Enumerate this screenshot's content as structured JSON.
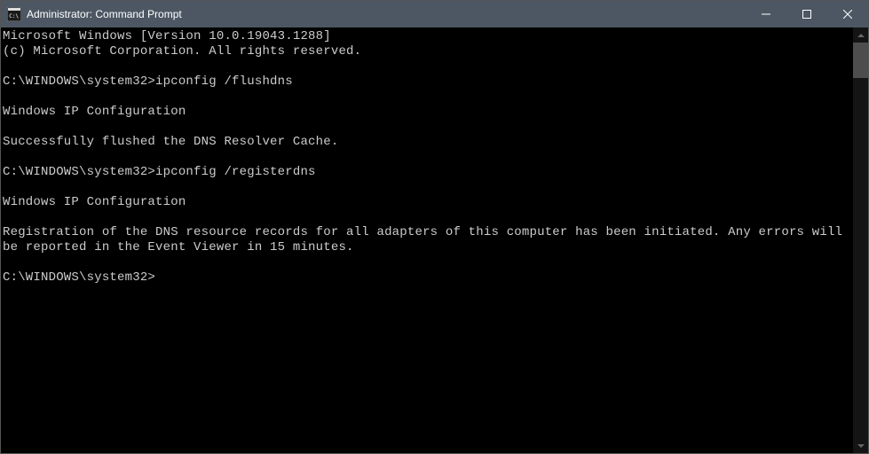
{
  "window": {
    "title": "Administrator: Command Prompt"
  },
  "terminal": {
    "lines": [
      "Microsoft Windows [Version 10.0.19043.1288]",
      "(c) Microsoft Corporation. All rights reserved.",
      "",
      "C:\\WINDOWS\\system32>ipconfig /flushdns",
      "",
      "Windows IP Configuration",
      "",
      "Successfully flushed the DNS Resolver Cache.",
      "",
      "C:\\WINDOWS\\system32>ipconfig /registerdns",
      "",
      "Windows IP Configuration",
      "",
      "Registration of the DNS resource records for all adapters of this computer has been initiated. Any errors will be reported in the Event Viewer in 15 minutes.",
      "",
      "C:\\WINDOWS\\system32>"
    ]
  }
}
